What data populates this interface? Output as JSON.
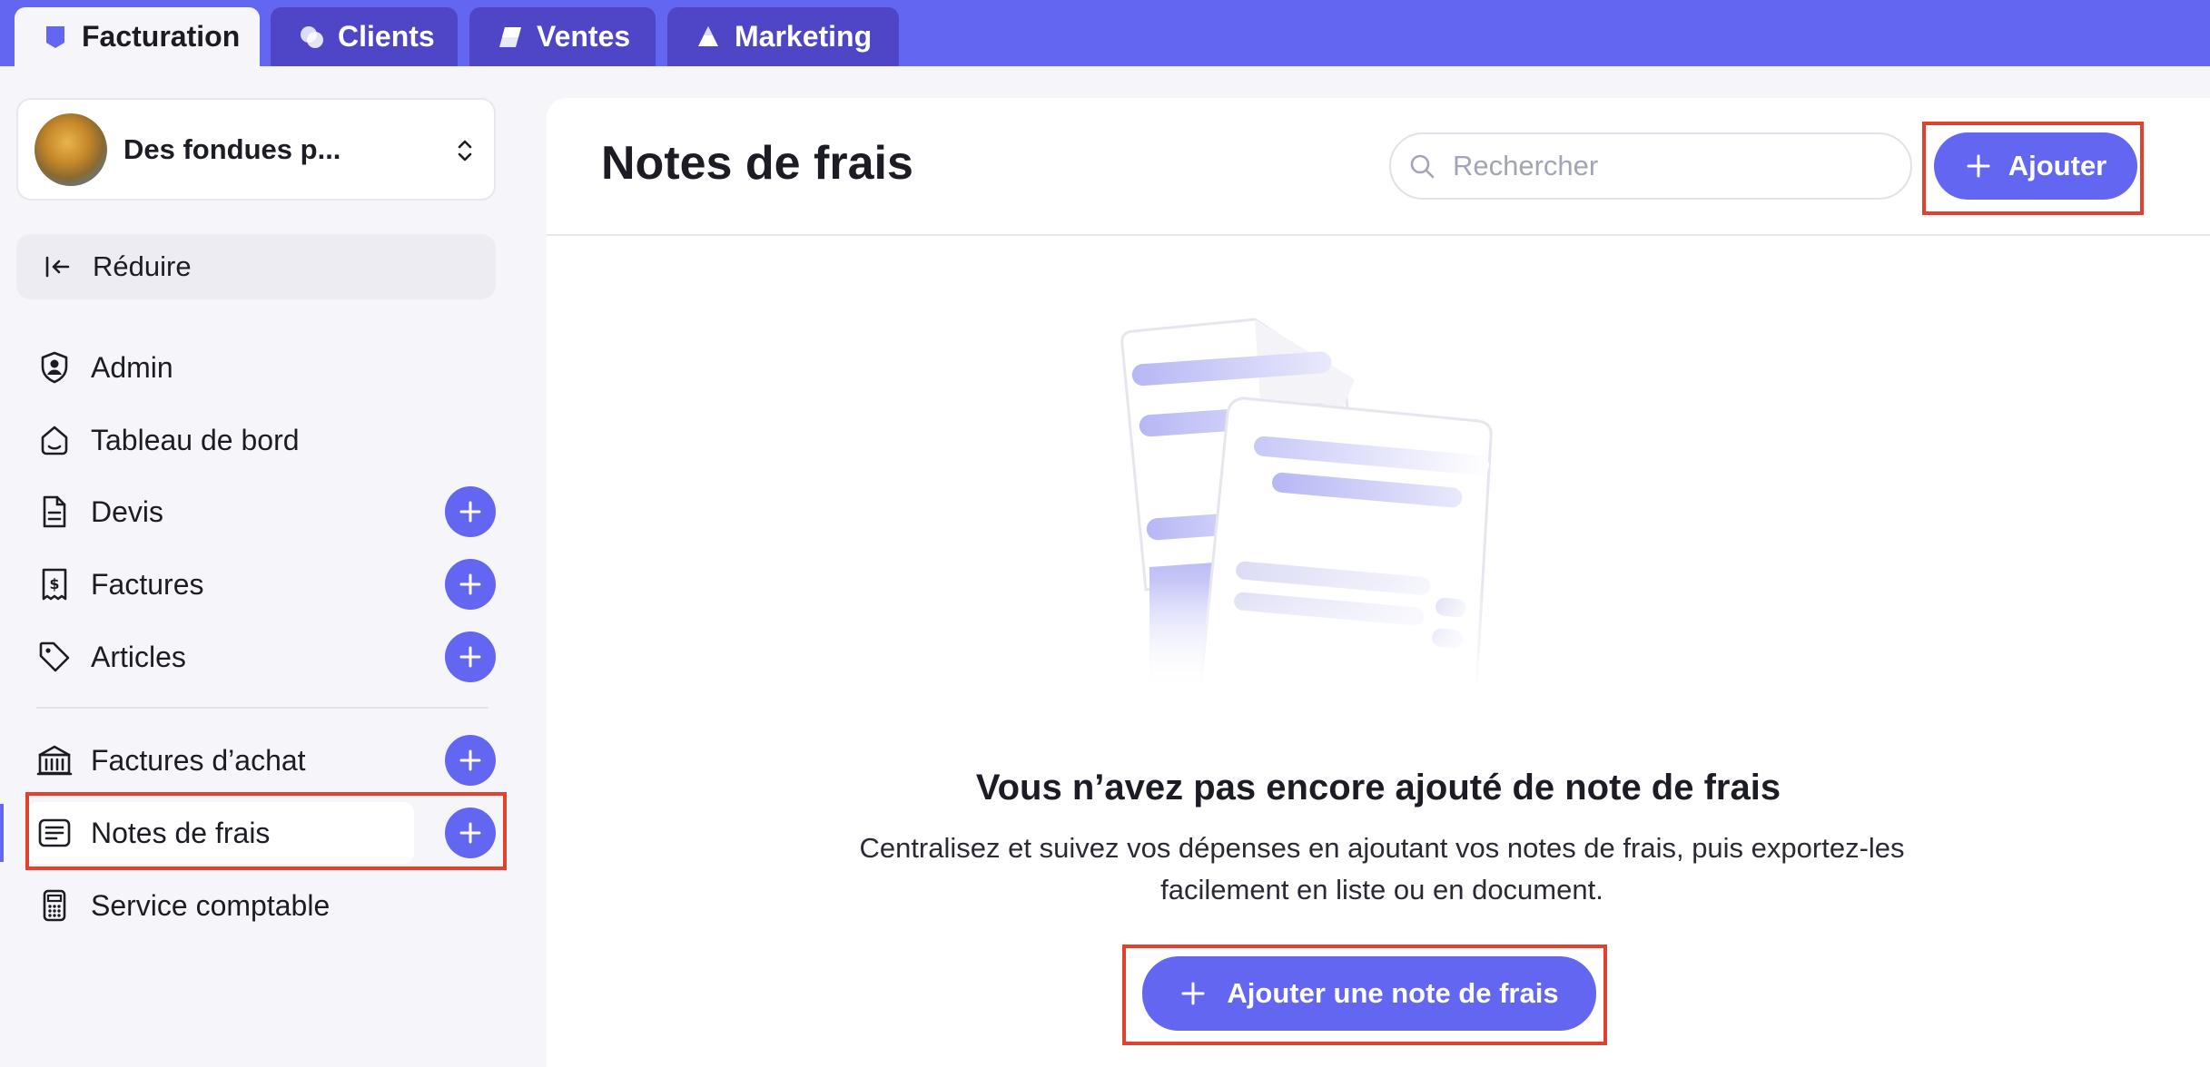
{
  "tabs": [
    {
      "label": "Facturation",
      "active": true,
      "icon": "facturation-icon"
    },
    {
      "label": "Clients",
      "active": false,
      "icon": "clients-icon"
    },
    {
      "label": "Ventes",
      "active": false,
      "icon": "ventes-icon"
    },
    {
      "label": "Marketing",
      "active": false,
      "icon": "marketing-icon"
    }
  ],
  "sidebar": {
    "company_name": "Des fondues p...",
    "collapse_label": "Réduire",
    "items": [
      {
        "label": "Admin",
        "icon": "shield-user-icon",
        "has_add": false
      },
      {
        "label": "Tableau de bord",
        "icon": "dashboard-icon",
        "has_add": false
      },
      {
        "label": "Devis",
        "icon": "document-icon",
        "has_add": true
      },
      {
        "label": "Factures",
        "icon": "invoice-dollar-icon",
        "has_add": true
      },
      {
        "label": "Articles",
        "icon": "tag-icon",
        "has_add": true
      },
      {
        "label": "Factures d’achat",
        "icon": "bank-icon",
        "has_add": true
      },
      {
        "label": "Notes de frais",
        "icon": "note-icon",
        "has_add": true,
        "active": true
      },
      {
        "label": "Service comptable",
        "icon": "calculator-icon",
        "has_add": false
      }
    ]
  },
  "main": {
    "title": "Notes de frais",
    "search_placeholder": "Rechercher",
    "add_label": "Ajouter",
    "empty_title": "Vous n’avez pas encore ajouté de note de frais",
    "empty_description": "Centralisez et suivez vos dépenses en ajoutant vos notes de frais, puis exportez-les facilement en liste ou en document.",
    "cta_label": "Ajouter une note de frais"
  },
  "colors": {
    "accent": "#6366f1",
    "tab_inactive": "#4f46c7",
    "highlight": "#e2412e",
    "background": "#f6f6fa"
  }
}
